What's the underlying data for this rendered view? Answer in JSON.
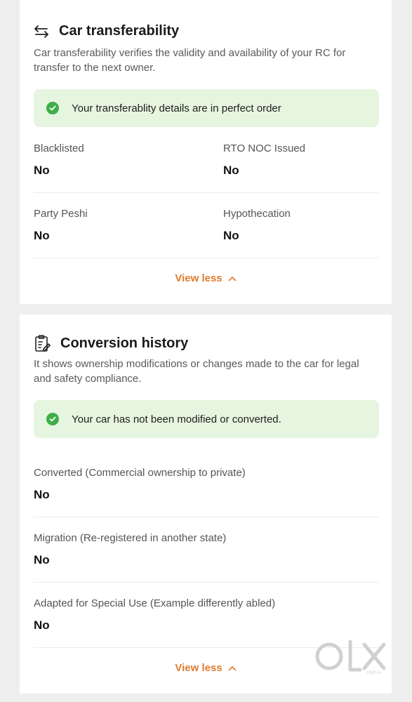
{
  "transferability": {
    "title": "Car transferability",
    "description": "Car transferability verifies the validity and availability of your RC for transfer to the next owner.",
    "banner": "Your transferablity details are in perfect order",
    "fields": [
      {
        "label": "Blacklisted",
        "value": "No"
      },
      {
        "label": "RTO NOC Issued",
        "value": "No"
      },
      {
        "label": "Party Peshi",
        "value": "No"
      },
      {
        "label": "Hypothecation",
        "value": "No"
      }
    ],
    "toggle_label": "View less"
  },
  "conversion": {
    "title": "Conversion history",
    "description": "It shows ownership modifications or changes made to the car for legal and safety compliance.",
    "banner": "Your car has not been modified or converted.",
    "fields": [
      {
        "label": "Converted (Commercial ownership to private)",
        "value": "No"
      },
      {
        "label": "Migration (Re-registered in another state)",
        "value": "No"
      },
      {
        "label": "Adapted for Special Use (Example differently abled)",
        "value": "No"
      }
    ],
    "toggle_label": "View less"
  },
  "watermark": {
    "brand": "OLX",
    "region": "INDIA"
  },
  "colors": {
    "accent": "#e07b2f",
    "success": "#3fae49",
    "banner_bg": "#e6f5df"
  },
  "icons": [
    "transfer-arrows-icon",
    "clipboard-edit-icon",
    "check-circle-icon",
    "chevron-up-icon"
  ]
}
